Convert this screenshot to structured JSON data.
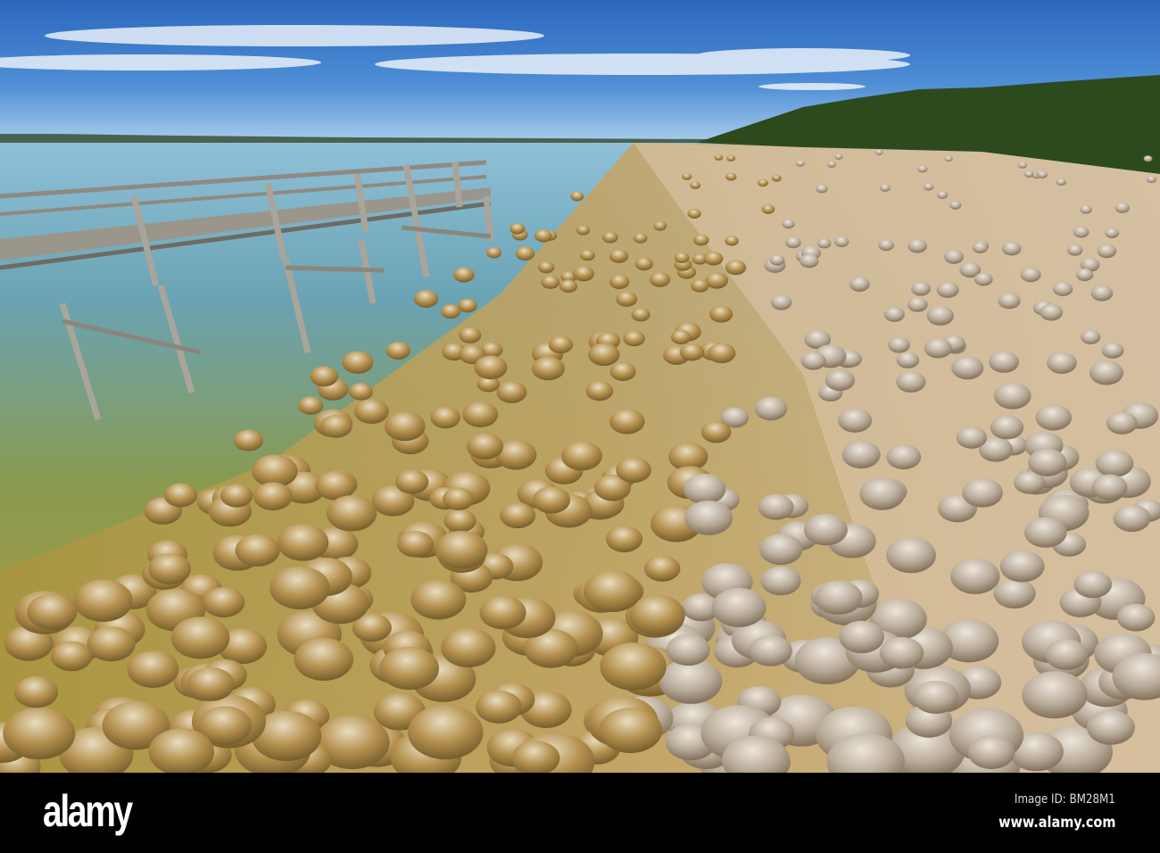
{
  "photo": {
    "subject": "jetty-over-lake-with-stromatolites",
    "colors": {
      "sky_top": "#2f6fc4",
      "sky_horizon": "#9cc6ea",
      "water": "#6ea6c0",
      "shallow": "#b79a4a",
      "sand": "#d9c3a6",
      "trees": "#2d4a1e"
    }
  },
  "footer": {
    "logo": "alamy",
    "image_id": "Image ID: BM28M1",
    "url": "www.alamy.com"
  }
}
